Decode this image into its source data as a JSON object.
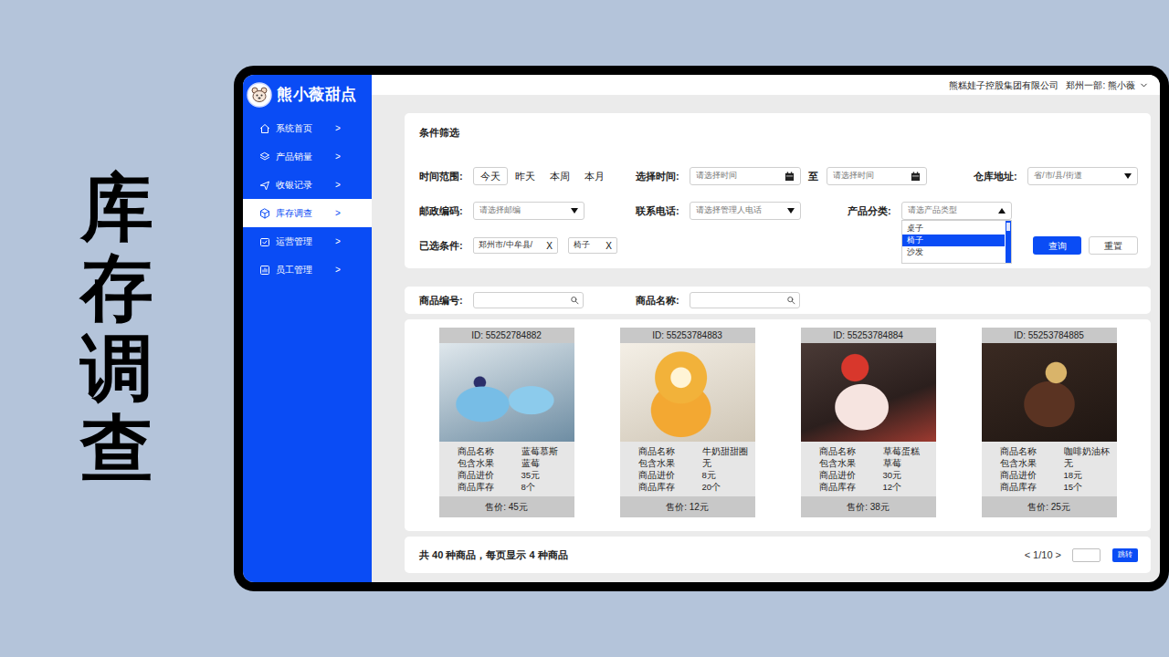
{
  "title": "库存调查",
  "logo": {
    "text": "熊小薇甜点"
  },
  "sidebar": {
    "items": [
      {
        "label": "系统首页",
        "chevron": ">",
        "selected": false
      },
      {
        "label": "产品销量",
        "chevron": ">",
        "selected": false
      },
      {
        "label": "收银记录",
        "chevron": ">",
        "selected": false
      },
      {
        "label": "库存调查",
        "chevron": ">",
        "selected": true
      },
      {
        "label": "运营管理",
        "chevron": ">",
        "selected": false
      },
      {
        "label": "员工管理",
        "chevron": ">",
        "selected": false
      }
    ]
  },
  "header": {
    "company": "熊糕娃子控股集团有限公司",
    "user": "郑州一部: 熊小薇"
  },
  "filter": {
    "title": "条件筛选",
    "time_range": {
      "label": "时间范围:",
      "options": [
        {
          "label": "今天",
          "selected": true
        },
        {
          "label": "昨天",
          "selected": false
        },
        {
          "label": "本周",
          "selected": false
        },
        {
          "label": "本月",
          "selected": false
        }
      ]
    },
    "select_time": {
      "label": "选择时间:",
      "start": "请选择时间",
      "to": "至",
      "end": "请选择时间"
    },
    "warehouse": {
      "label": "仓库地址:",
      "placeholder": "省/市/县/街道"
    },
    "postcode": {
      "label": "邮政编码:",
      "placeholder": "请选择邮编"
    },
    "phone": {
      "label": "联系电话:",
      "placeholder": "请选择管理人电话"
    },
    "category": {
      "label": "产品分类:",
      "placeholder": "请选产品类型",
      "expanded": true,
      "options": [
        {
          "label": "桌子",
          "selected": false
        },
        {
          "label": "椅子",
          "selected": true
        },
        {
          "label": "沙发",
          "selected": false
        }
      ]
    },
    "chosen": {
      "label": "已选条件:",
      "tags": [
        {
          "text": "郑州市/中牟县/",
          "remove": "X"
        },
        {
          "text": "椅子",
          "remove": "X"
        }
      ]
    },
    "query": "查询",
    "reset": "重置"
  },
  "search": {
    "code_label": "商品编号:",
    "name_label": "商品名称:"
  },
  "products": [
    {
      "id": "ID: 55252784882",
      "fields": [
        {
          "label": "商品名称",
          "value": "蓝莓慕斯"
        },
        {
          "label": "包含水果",
          "value": "蓝莓"
        },
        {
          "label": "商品进价",
          "value": "35元"
        },
        {
          "label": "商品库存",
          "value": "8个"
        }
      ],
      "price": "售价: 45元"
    },
    {
      "id": "ID: 55253784883",
      "fields": [
        {
          "label": "商品名称",
          "value": "牛奶甜甜圈"
        },
        {
          "label": "包含水果",
          "value": "无"
        },
        {
          "label": "商品进价",
          "value": "8元"
        },
        {
          "label": "商品库存",
          "value": "20个"
        }
      ],
      "price": "售价: 12元"
    },
    {
      "id": "ID: 55253784884",
      "fields": [
        {
          "label": "商品名称",
          "value": "草莓蛋糕"
        },
        {
          "label": "包含水果",
          "value": "草莓"
        },
        {
          "label": "商品进价",
          "value": "30元"
        },
        {
          "label": "商品库存",
          "value": "12个"
        }
      ],
      "price": "售价: 38元"
    },
    {
      "id": "ID: 55253784885",
      "fields": [
        {
          "label": "商品名称",
          "value": "咖啡奶油杯"
        },
        {
          "label": "包含水果",
          "value": "无"
        },
        {
          "label": "商品进价",
          "value": "18元"
        },
        {
          "label": "商品库存",
          "value": "15个"
        }
      ],
      "price": "售价: 25元"
    }
  ],
  "pager": {
    "summary": "共 40 种商品，每页显示 4 种商品",
    "pages": "< 1/10 >",
    "jump": "跳转"
  }
}
